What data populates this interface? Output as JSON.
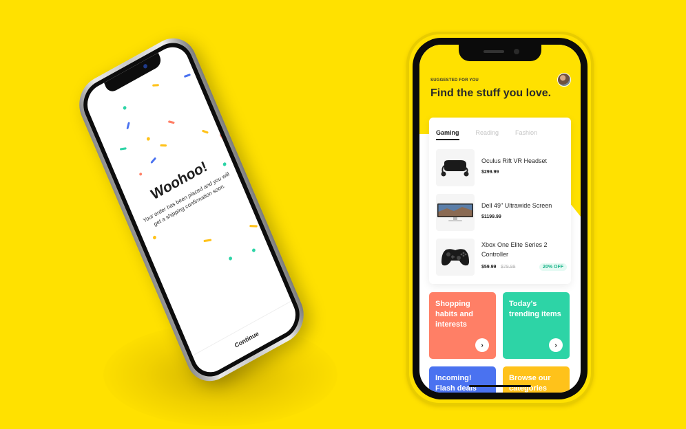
{
  "confirmation": {
    "title": "Woohoo!",
    "message": "Your order has been placed and you will get a shipping confirmation soon.",
    "continue_label": "Continue"
  },
  "home": {
    "suggest_label": "SUGGESTED FOR YOU",
    "title": "Find the stuff you love.",
    "tabs": [
      {
        "label": "Gaming"
      },
      {
        "label": "Reading"
      },
      {
        "label": "Fashion"
      }
    ],
    "products": [
      {
        "name": "Oculus Rift VR Headset",
        "price": "$299.99",
        "icon": "vr-headset-icon"
      },
      {
        "name": "Dell 49\" Ultrawide Screen",
        "price": "$1199.99",
        "icon": "monitor-icon"
      },
      {
        "name": "Xbox One Elite Series 2 Controller",
        "price": "$59.99",
        "old_price": "$79.99",
        "discount": "20% OFF",
        "icon": "gamepad-icon"
      }
    ],
    "tiles": [
      {
        "label": "Shopping habits and interests",
        "color": "#FF7F66"
      },
      {
        "label": "Today's trending items",
        "color": "#2DD4A6"
      },
      {
        "label": "Incoming! Flash deals",
        "color": "#4A72F0"
      },
      {
        "label": "Browse our categories",
        "color": "#FFC21A"
      }
    ]
  },
  "colors": {
    "background": "#FFE100",
    "accent_green": "#1BB38A"
  }
}
